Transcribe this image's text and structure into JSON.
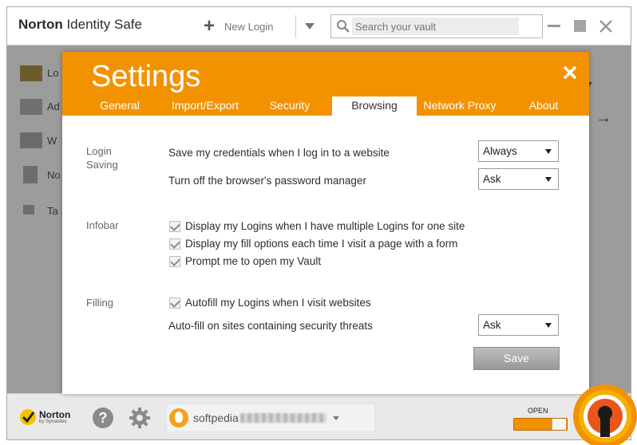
{
  "app": {
    "title_bold": "Norton",
    "title_rest": "Identity Safe",
    "new_login_label": "New Login",
    "search_placeholder": "Search your vault"
  },
  "sidebar": {
    "items": [
      {
        "label": "Lo",
        "icon": "logins-icon"
      },
      {
        "label": "Ad",
        "icon": "address-card-icon"
      },
      {
        "label": "W",
        "icon": "wallet-icon"
      },
      {
        "label": "No",
        "icon": "notes-icon"
      },
      {
        "label": "Ta",
        "icon": "tag-icon"
      }
    ]
  },
  "settings": {
    "title": "Settings",
    "tabs": [
      {
        "label": "General"
      },
      {
        "label": "Import/Export"
      },
      {
        "label": "Security"
      },
      {
        "label": "Browsing",
        "active": true
      },
      {
        "label": "Network Proxy"
      },
      {
        "label": "About"
      }
    ],
    "login_saving": {
      "label_line1": "Login",
      "label_line2": "Saving",
      "rows": [
        {
          "text": "Save my credentials when I log in to a website",
          "value": "Always"
        },
        {
          "text": "Turn off the browser's password manager",
          "value": "Ask"
        }
      ]
    },
    "infobar": {
      "label": "Infobar",
      "checks": [
        {
          "text": "Display my Logins when I have multiple Logins for one site",
          "checked": true
        },
        {
          "text": "Display my fill options each time I visit a page with a form",
          "checked": true
        },
        {
          "text": "Prompt me to open my Vault",
          "checked": true
        }
      ]
    },
    "filling": {
      "label": "Filling",
      "check": {
        "text": "Autofill my Logins when I visit websites",
        "checked": true
      },
      "row": {
        "text": "Auto-fill on sites containing security threats",
        "value": "Ask"
      }
    },
    "save_label": "Save"
  },
  "bottom": {
    "brand": "Norton",
    "brand_sub": "by Symantec",
    "account_name": "softpedia",
    "vault_status": "OPEN"
  },
  "colors": {
    "accent": "#f39200",
    "window_bg": "#9c9c9c"
  }
}
